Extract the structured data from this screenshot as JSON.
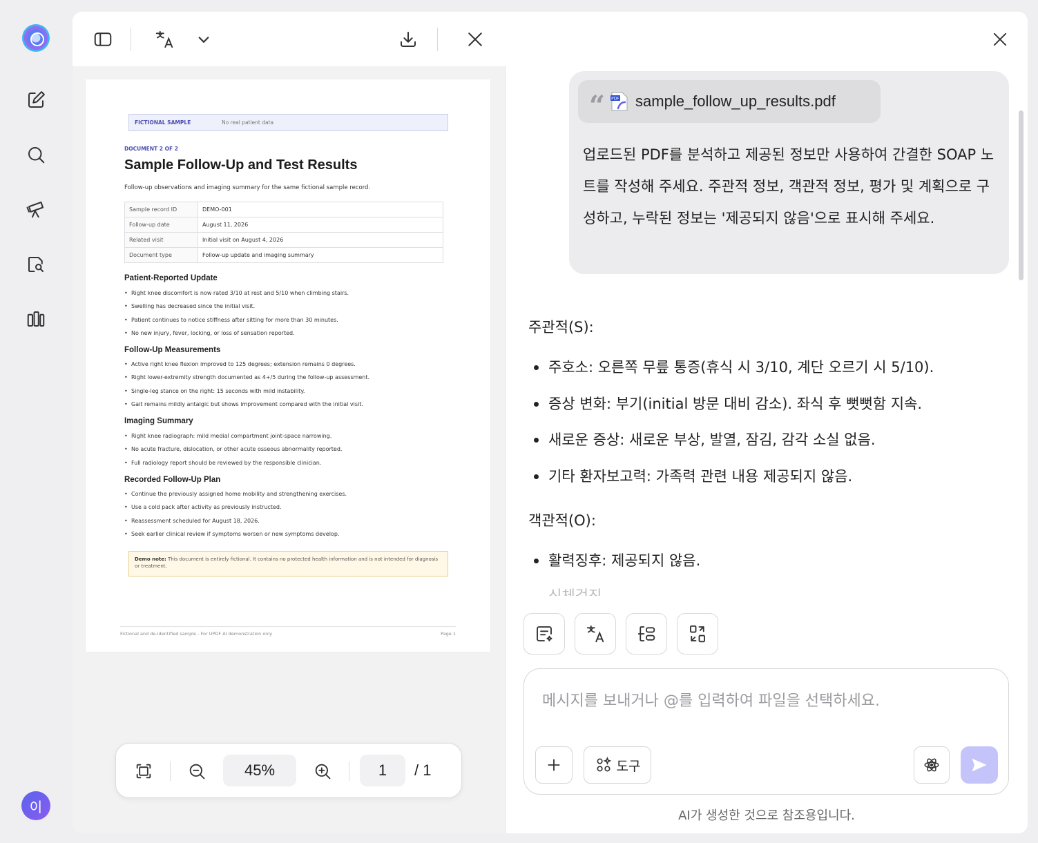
{
  "app": {
    "avatar_letter": "이"
  },
  "pdf_toolbar": {
    "translate_glyph": "文A"
  },
  "document": {
    "banner_label": "FICTIONAL SAMPLE",
    "banner_note": "No real patient data",
    "doc_label": "DOCUMENT 2 OF 2",
    "title": "Sample Follow-Up and Test Results",
    "subtitle": "Follow-up observations and imaging summary for the same fictional sample record.",
    "meta_rows": [
      {
        "key": "Sample record ID",
        "value": "DEMO-001"
      },
      {
        "key": "Follow-up date",
        "value": "August 11, 2026"
      },
      {
        "key": "Related visit",
        "value": "Initial visit on August 4, 2026"
      },
      {
        "key": "Document type",
        "value": "Follow-up update and imaging summary"
      }
    ],
    "sections": [
      {
        "heading": "Patient-Reported Update",
        "items": [
          "Right knee discomfort is now rated 3/10 at rest and 5/10 when climbing stairs.",
          "Swelling has decreased since the initial visit.",
          "Patient continues to notice stiffness after sitting for more than 30 minutes.",
          "No new injury, fever, locking, or loss of sensation reported."
        ]
      },
      {
        "heading": "Follow-Up Measurements",
        "items": [
          "Active right knee flexion improved to 125 degrees; extension remains 0 degrees.",
          "Right lower-extremity strength documented as 4+/5 during the follow-up assessment.",
          "Single-leg stance on the right: 15 seconds with mild instability.",
          "Gait remains mildly antalgic but shows improvement compared with the initial visit."
        ]
      },
      {
        "heading": "Imaging Summary",
        "items": [
          "Right knee radiograph: mild medial compartment joint-space narrowing.",
          "No acute fracture, dislocation, or other acute osseous abnormality reported.",
          "Full radiology report should be reviewed by the responsible clinician."
        ]
      },
      {
        "heading": "Recorded Follow-Up Plan",
        "items": [
          "Continue the previously assigned home mobility and strengthening exercises.",
          "Use a cold pack after activity as previously instructed.",
          "Reassessment scheduled for August 18, 2026.",
          "Seek earlier clinical review if symptoms worsen or new symptoms develop."
        ]
      }
    ],
    "note_label": "Demo note:",
    "note_text": "This document is entirely fictional. It contains no protected health information and is not intended for diagnosis or treatment.",
    "footer_left": "Fictional and de-identified sample - For UPDF AI demonstration only",
    "footer_right": "Page 1"
  },
  "zoom": {
    "percent": "45%",
    "current_page": "1",
    "total_pages": "/ 1"
  },
  "chat": {
    "attachment_name": "sample_follow_up_results.pdf",
    "user_message": "업로드된 PDF를 분석하고 제공된 정보만 사용하여 간결한 SOAP 노트를 작성해 주세요. 주관적 정보, 객관적 정보, 평가 및 계획으로 구성하고, 누락된 정보는 '제공되지 않음'으로 표시해 주세요.",
    "subjective_heading": "주관적(S):",
    "subjective_items": [
      "주호소: 오른쪽 무릎 통증(휴식 시 3/10, 계단 오르기 시 5/10).",
      "증상 변화: 부기(initial 방문 대비 감소). 좌식 후 뻣뻣함 지속.",
      "새로운 증상: 새로운 부상, 발열, 잠김, 감각 소실 없음.",
      "기타 환자보고력: 가족력 관련 내용 제공되지 않음."
    ],
    "objective_heading": "객관적(O):",
    "objective_items": [
      "활력징후: 제공되지 않음."
    ],
    "faded_next": "신체검진",
    "input_placeholder": "메시지를 보내거나 @를 입력하여 파일을 선택하세요.",
    "tools_label": "도구",
    "disclaimer": "AI가 생성한 것으로 참조용입니다."
  }
}
